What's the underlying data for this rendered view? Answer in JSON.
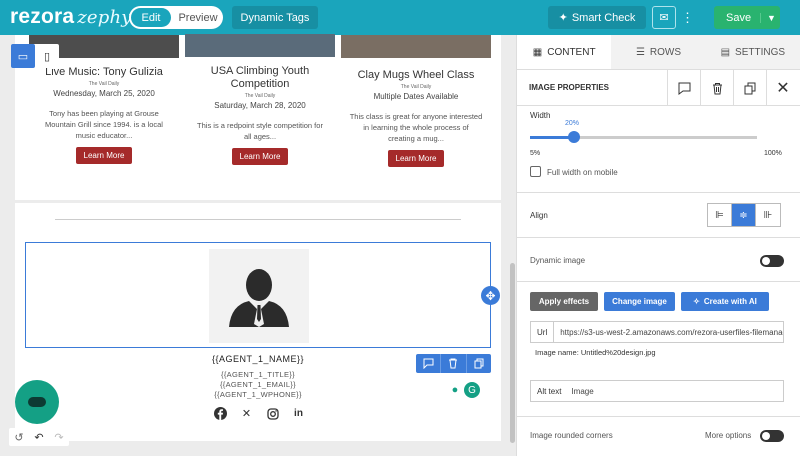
{
  "header": {
    "logo_main": "rezora",
    "logo_sub": "zephyr",
    "edit_label": "Edit",
    "preview_label": "Preview",
    "tags_label": "Dynamic Tags",
    "smart_check_label": "Smart Check",
    "save_label": "Save"
  },
  "events": [
    {
      "title": "Live Music: Tony Gulizia",
      "source": "The Vail Daily",
      "date": "Wednesday, March 25, 2020",
      "desc": "Tony has been playing at Grouse Mountain Grill since 1994. is a local music educator...",
      "button": "Learn More"
    },
    {
      "title": "USA Climbing Youth Competition",
      "source": "The Vail Daily",
      "date": "Saturday, March 28, 2020",
      "desc": "This is a redpoint style competition for all ages...",
      "button": "Learn More"
    },
    {
      "title": "Clay Mugs Wheel Class",
      "source": "The Vail Daily",
      "date": "Multiple Dates Available",
      "desc": "This class is great for anyone interested in learning the whole process of creating a mug...",
      "button": "Learn More"
    }
  ],
  "agent": {
    "name": "{{AGENT_1_NAME}}",
    "title": "{{AGENT_1_TITLE}}",
    "email": "{{AGENT_1_EMAIL}}",
    "phone": "{{AGENT_1_WPHONE}}"
  },
  "panel": {
    "tabs": [
      "CONTENT",
      "ROWS",
      "SETTINGS"
    ],
    "section_title": "IMAGE PROPERTIES",
    "width_label": "Width",
    "width_value": "20%",
    "width_fraction": 0.2,
    "min_label": "5%",
    "max_label": "100%",
    "full_width_label": "Full width on mobile",
    "align_label": "Align",
    "dynamic_label": "Dynamic image",
    "apply_label": "Apply effects",
    "change_label": "Change image",
    "ai_label": "Create with AI",
    "url_key": "Url",
    "url_value": "https://s3-us-west-2.amazonaws.com/rezora-userfiles-filemanager",
    "image_name": "Image name: Untitled%20design.jpg",
    "alt_key": "Alt text",
    "alt_value": "Image",
    "rounded_label": "Image rounded corners",
    "more_options": "More options"
  },
  "colors": {
    "brand": "#1aa5bc",
    "accent": "#3b7bd8",
    "save": "#29b36f",
    "learn_more": "#a52a2a",
    "chat": "#14a085"
  }
}
